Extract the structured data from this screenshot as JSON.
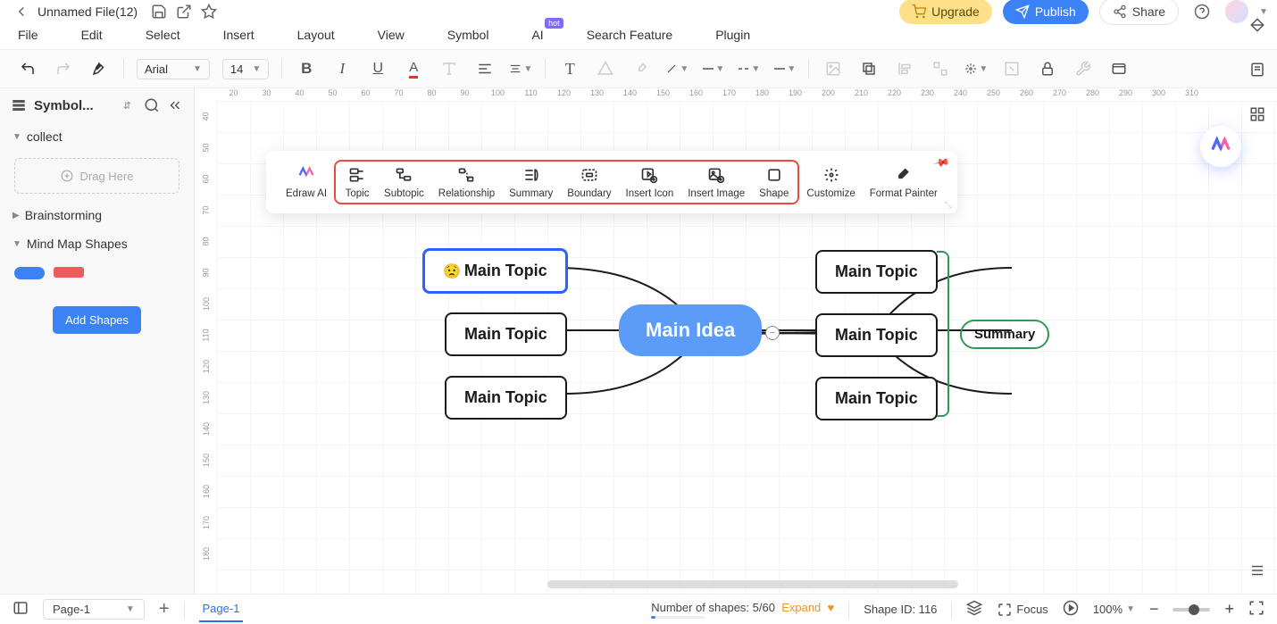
{
  "header": {
    "file_name": "Unnamed File(12)",
    "upgrade": "Upgrade",
    "publish": "Publish",
    "share": "Share"
  },
  "menu": {
    "file": "File",
    "edit": "Edit",
    "select": "Select",
    "insert": "Insert",
    "layout": "Layout",
    "view": "View",
    "symbol": "Symbol",
    "ai": "AI",
    "ai_badge": "hot",
    "search": "Search Feature",
    "plugin": "Plugin"
  },
  "toolbar": {
    "font": "Arial",
    "size": "14"
  },
  "sidebar": {
    "title": "Symbol...",
    "cat_collect": "collect",
    "drag_here": "Drag Here",
    "cat_brainstorming": "Brainstorming",
    "cat_mindmap": "Mind Map Shapes",
    "add_shapes": "Add Shapes"
  },
  "float_tools": {
    "edraw_ai": "Edraw AI",
    "topic": "Topic",
    "subtopic": "Subtopic",
    "relationship": "Relationship",
    "summary": "Summary",
    "boundary": "Boundary",
    "insert_icon": "Insert Icon",
    "insert_image": "Insert Image",
    "shape": "Shape",
    "customize": "Customize",
    "format_painter": "Format Painter"
  },
  "mindmap": {
    "main_idea": "Main Idea",
    "left1": "Main Topic",
    "left2": "Main Topic",
    "left3": "Main Topic",
    "right1": "Main Topic",
    "right2": "Main Topic",
    "right3": "Main Topic",
    "summary": "Summary",
    "emoji": "😟"
  },
  "ruler_h": [
    "20",
    "30",
    "40",
    "50",
    "60",
    "70",
    "80",
    "90",
    "100",
    "110",
    "120",
    "130",
    "140",
    "150",
    "160",
    "170",
    "180",
    "190",
    "200",
    "210",
    "220",
    "230",
    "240",
    "250",
    "260",
    "270",
    "280",
    "290",
    "300",
    "310"
  ],
  "ruler_v": [
    "40",
    "50",
    "60",
    "70",
    "80",
    "90",
    "100",
    "110",
    "120",
    "130",
    "140",
    "150",
    "160",
    "170",
    "180"
  ],
  "status": {
    "page_sel": "Page-1",
    "page_tab": "Page-1",
    "shapes_label": "Number of shapes: 5/60",
    "expand": "Expand",
    "shape_id_label": "Shape ID: 116",
    "focus": "Focus",
    "zoom": "100%"
  }
}
